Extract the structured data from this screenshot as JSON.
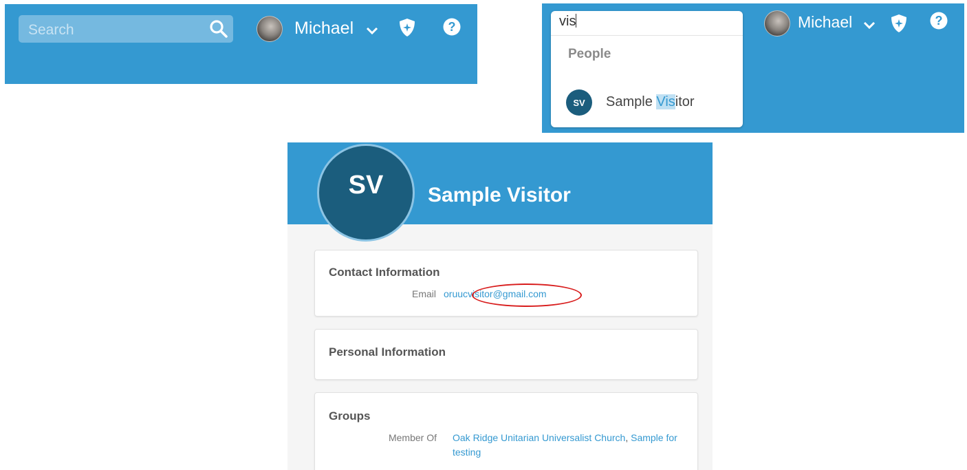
{
  "header": {
    "search_placeholder": "Search",
    "user_name": "Michael",
    "icons": [
      "search-icon",
      "chevron-down-icon",
      "shield-icon",
      "help-icon"
    ]
  },
  "search_dropdown": {
    "query": "vis",
    "section_label": "People",
    "result": {
      "initials": "SV",
      "name_before": "Sample ",
      "name_match": "Vis",
      "name_after": "itor"
    }
  },
  "profile": {
    "initials": "SV",
    "name": "Sample Visitor",
    "contact": {
      "title": "Contact Information",
      "email_label": "Email",
      "email_value": "oruucvisitor@gmail.com"
    },
    "personal": {
      "title": "Personal Information"
    },
    "groups": {
      "title": "Groups",
      "member_of_label": "Member Of",
      "group_1": "Oak Ridge Unitarian Universalist Church",
      "separator": ", ",
      "group_2": "Sample for testing"
    }
  },
  "colors": {
    "header_blue": "#3499d1",
    "avatar_navy": "#1b5d7d",
    "link_blue": "#3499d1",
    "annotation_red": "#d81c1c",
    "match_highlight": "#bfe0f3"
  }
}
